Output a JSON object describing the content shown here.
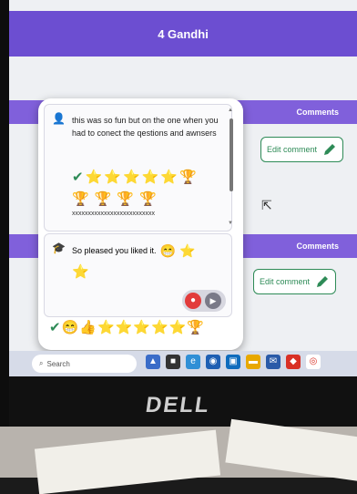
{
  "header": {
    "title": "4 Gandhi"
  },
  "bands": [
    {
      "label": "Comments"
    },
    {
      "label": "Comments"
    }
  ],
  "edit_buttons": [
    {
      "label": "Edit comment"
    },
    {
      "label": "Edit comment"
    }
  ],
  "popup": {
    "comment1": {
      "text": "this was so fun but on the one when you had to conect the qestions and awnsers",
      "emoji_row1": [
        "✔",
        "⭐",
        "⭐",
        "⭐",
        "⭐",
        "⭐",
        "🏆"
      ],
      "emoji_row2": [
        "🏆",
        "🏆",
        "🏆",
        "🏆"
      ],
      "filler": "xxxxxxxxxxxxxxxxxxxxxxxxxx"
    },
    "comment2": {
      "text": "So pleased you liked it.",
      "stars": [
        "⭐"
      ]
    },
    "reaction_bar": [
      "✔",
      "😁",
      "👍",
      "⭐",
      "⭐",
      "⭐",
      "⭐",
      "⭐",
      "🏆"
    ]
  },
  "taskbar": {
    "search_placeholder": "Search"
  },
  "brand": "DELL",
  "colors": {
    "purple_header": "#6c4ed1",
    "purple_band": "#8060db",
    "green": "#2e8b57",
    "mic_red": "#e23b3b"
  }
}
